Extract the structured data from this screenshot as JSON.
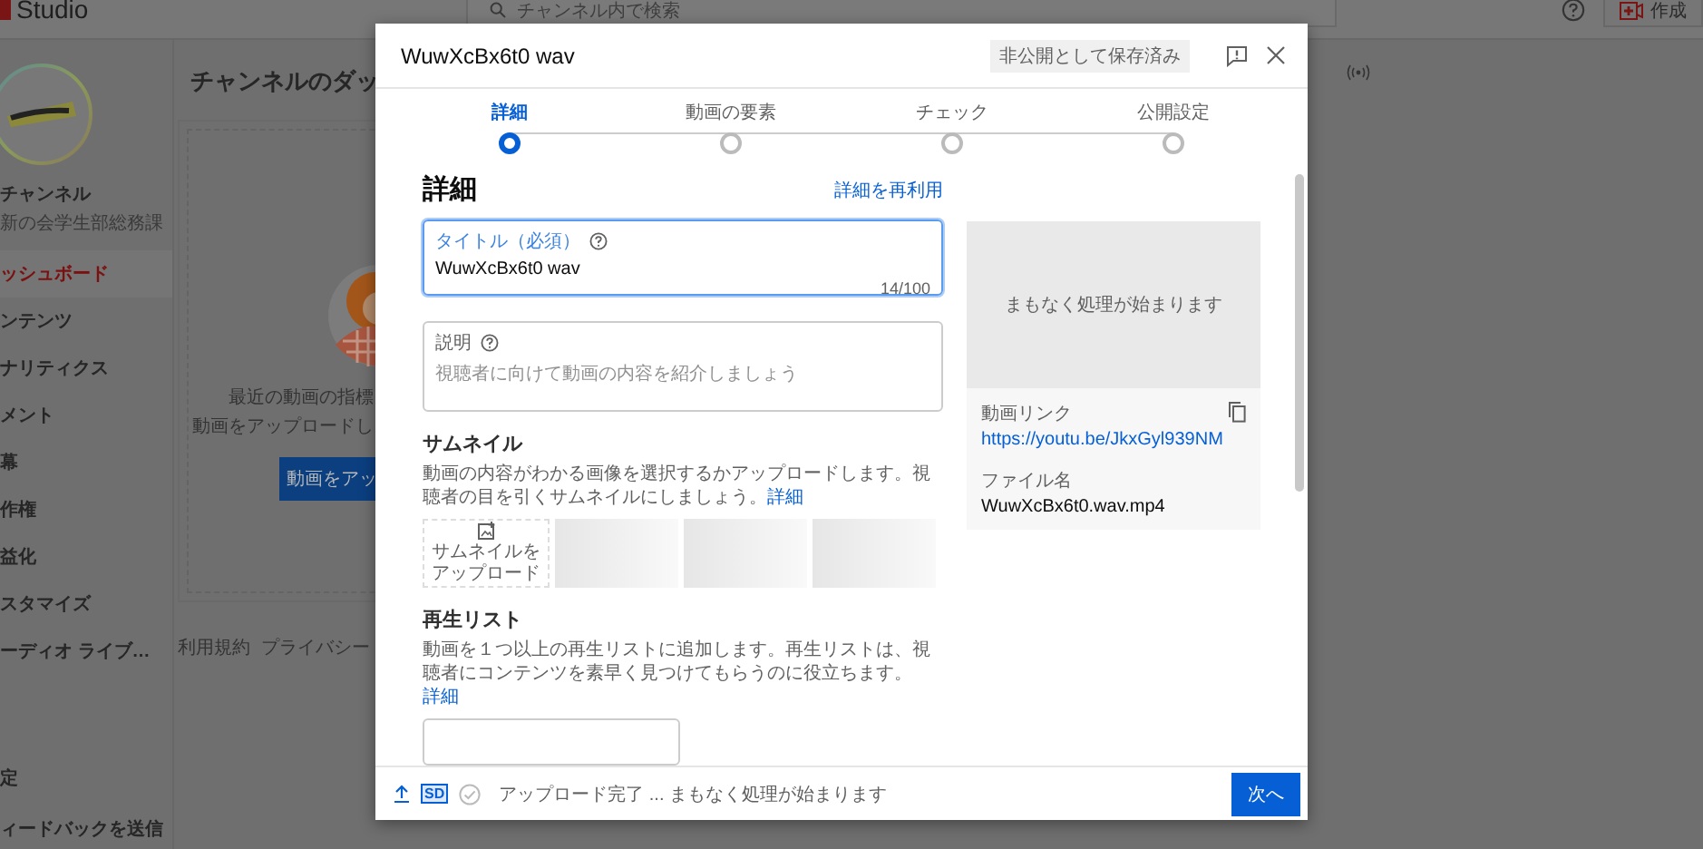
{
  "backdrop": {
    "header": {
      "logo_text": "Studio",
      "search": {
        "placeholder": "チャンネル内で検索"
      },
      "create_button": "作成"
    },
    "sidebar": {
      "channel_name": "チャンネル",
      "channel_subtitle": "新の会学生部総務課",
      "items": [
        {
          "label": "ッシュボード",
          "selected": true
        },
        {
          "label": "ンテンツ",
          "selected": false
        },
        {
          "label": "ナリティクス",
          "selected": false
        },
        {
          "label": "メント",
          "selected": false
        },
        {
          "label": "幕",
          "selected": false
        },
        {
          "label": "作権",
          "selected": false
        },
        {
          "label": "益化",
          "selected": false
        },
        {
          "label": "スタマイズ",
          "selected": false
        },
        {
          "label": "ーディオ ライブ…",
          "selected": false
        }
      ],
      "bottom_items": [
        "定",
        "ィードバックを送信"
      ]
    },
    "main": {
      "title": "チャンネルのダッ",
      "card": {
        "text_lines": [
          "最近の動画の指標",
          "動画をアップロードし"
        ],
        "button": "動画をアッ"
      },
      "footer_links": [
        "利用規約",
        "プライバシー"
      ]
    }
  },
  "dialog": {
    "title": "WuwXcBx6t0 wav",
    "status_chip": "非公開として保存済み",
    "steps": [
      {
        "label": "詳細",
        "selected": true
      },
      {
        "label": "動画の要素",
        "selected": false
      },
      {
        "label": "チェック",
        "selected": false
      },
      {
        "label": "公開設定",
        "selected": false
      }
    ],
    "section_title": "詳細",
    "reuse_link": "詳細を再利用",
    "fields": [
      {
        "kind": "title",
        "label": "タイトル（必須）",
        "value": "WuwXcBx6t0 wav",
        "counter": "14/100",
        "focused": true
      },
      {
        "kind": "description",
        "label": "説明",
        "placeholder": "視聴者に向けて動画の内容を紹介しましょう",
        "focused": false
      }
    ],
    "preview": {
      "status": "まもなく処理が始まります",
      "link_label": "動画リンク",
      "link": "https://youtu.be/JkxGyl939NM",
      "filename_label": "ファイル名",
      "filename": "WuwXcBx6t0.wav.mp4"
    },
    "thumbnails": {
      "title": "サムネイル",
      "description": "動画の内容がわかる画像を選択するかアップロードします。視聴者の目を引くサムネイルにしましょう。",
      "learn_more": "詳細",
      "slots": [
        {
          "kind": "upload",
          "label": "サムネイルをアップロード"
        },
        {
          "kind": "placeholder"
        },
        {
          "kind": "placeholder"
        },
        {
          "kind": "placeholder"
        }
      ]
    },
    "playlist": {
      "title": "再生リスト",
      "description": "動画を１つ以上の再生リストに追加します。再生リストは、視聴者にコンテンツを素早く見つけてもらうのに役立ちます。",
      "learn_more": "詳細"
    },
    "footer": {
      "quality_badge": "SD",
      "status": "アップロード完了 ... まもなく処理が始まります",
      "next_button": "次へ"
    }
  }
}
